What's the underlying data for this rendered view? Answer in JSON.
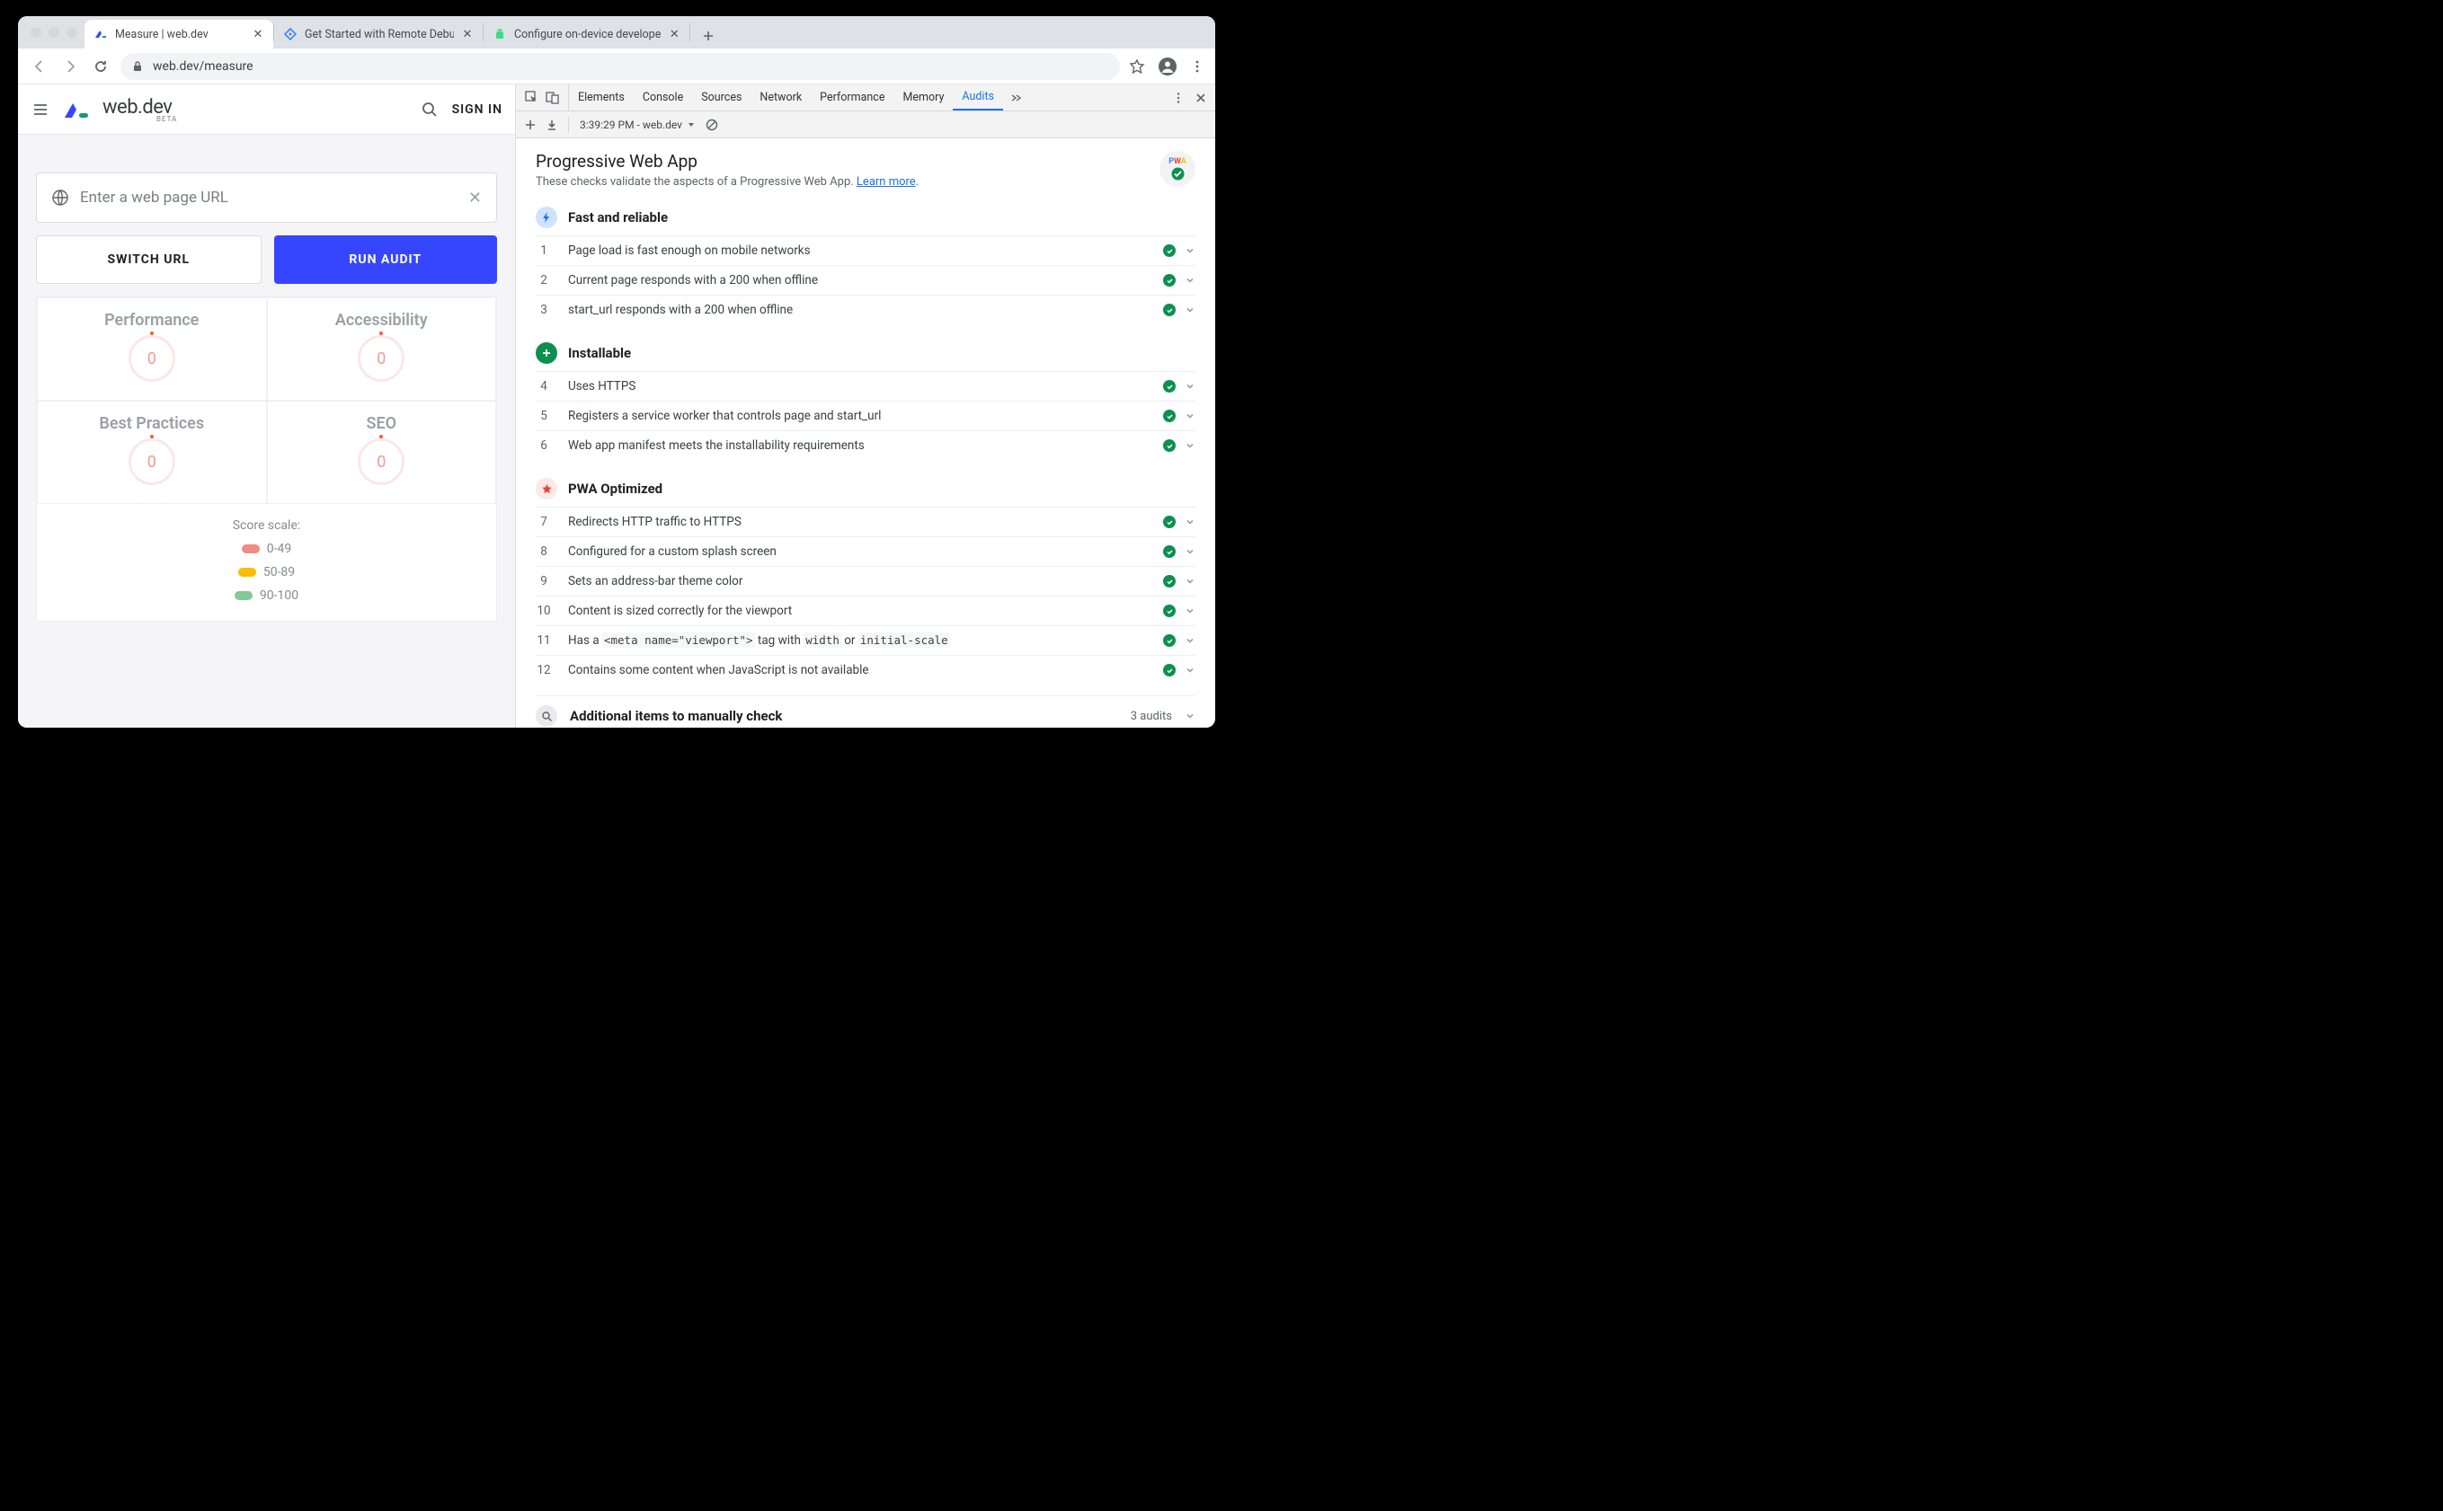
{
  "browser": {
    "tabs": [
      {
        "title": "Measure  |  web.dev"
      },
      {
        "title": "Get Started with Remote Debu"
      },
      {
        "title": "Configure on-device develope"
      }
    ],
    "url": "web.dev/measure"
  },
  "page": {
    "brand": "web.dev",
    "brand_sub": "BETA",
    "signin": "SIGN IN",
    "url_placeholder": "Enter a web page URL",
    "switch_btn": "SWITCH URL",
    "run_btn": "RUN AUDIT",
    "scores": [
      {
        "label": "Performance",
        "value": "0"
      },
      {
        "label": "Accessibility",
        "value": "0"
      },
      {
        "label": "Best Practices",
        "value": "0"
      },
      {
        "label": "SEO",
        "value": "0"
      }
    ],
    "scale": {
      "title": "Score scale:",
      "r0": "0-49",
      "r1": "50-89",
      "r2": "90-100"
    }
  },
  "devtools": {
    "tabs": [
      "Elements",
      "Console",
      "Sources",
      "Network",
      "Performance",
      "Memory",
      "Audits"
    ],
    "toolbar_time": "3:39:29 PM - web.dev",
    "report": {
      "title": "Progressive Web App",
      "desc": "These checks validate the aspects of a Progressive Web App. ",
      "learn": "Learn more",
      "badge_text": "PWA"
    },
    "sections": [
      {
        "icon": "bolt",
        "color": "blue",
        "title": "Fast and reliable",
        "start": 1,
        "items": [
          "Page load is fast enough on mobile networks",
          "Current page responds with a 200 when offline",
          "start_url responds with a 200 when offline"
        ]
      },
      {
        "icon": "plus",
        "color": "green",
        "title": "Installable",
        "start": 4,
        "items": [
          "Uses HTTPS",
          "Registers a service worker that controls page and start_url",
          "Web app manifest meets the installability requirements"
        ]
      },
      {
        "icon": "star",
        "color": "red",
        "title": "PWA Optimized",
        "start": 7,
        "items": [
          "Redirects HTTP traffic to HTTPS",
          "Configured for a custom splash screen",
          "Sets an address-bar theme color",
          "Content is sized correctly for the viewport",
          "__HTML__Has a <code class='inline'>&lt;meta name=\"viewport\"&gt;</code> tag with <code class='inline'>width</code> or <code class='inline'>initial-scale</code>",
          "Contains some content when JavaScript is not available"
        ]
      }
    ],
    "manual": {
      "title": "Additional items to manually check",
      "count": "3 audits"
    }
  }
}
